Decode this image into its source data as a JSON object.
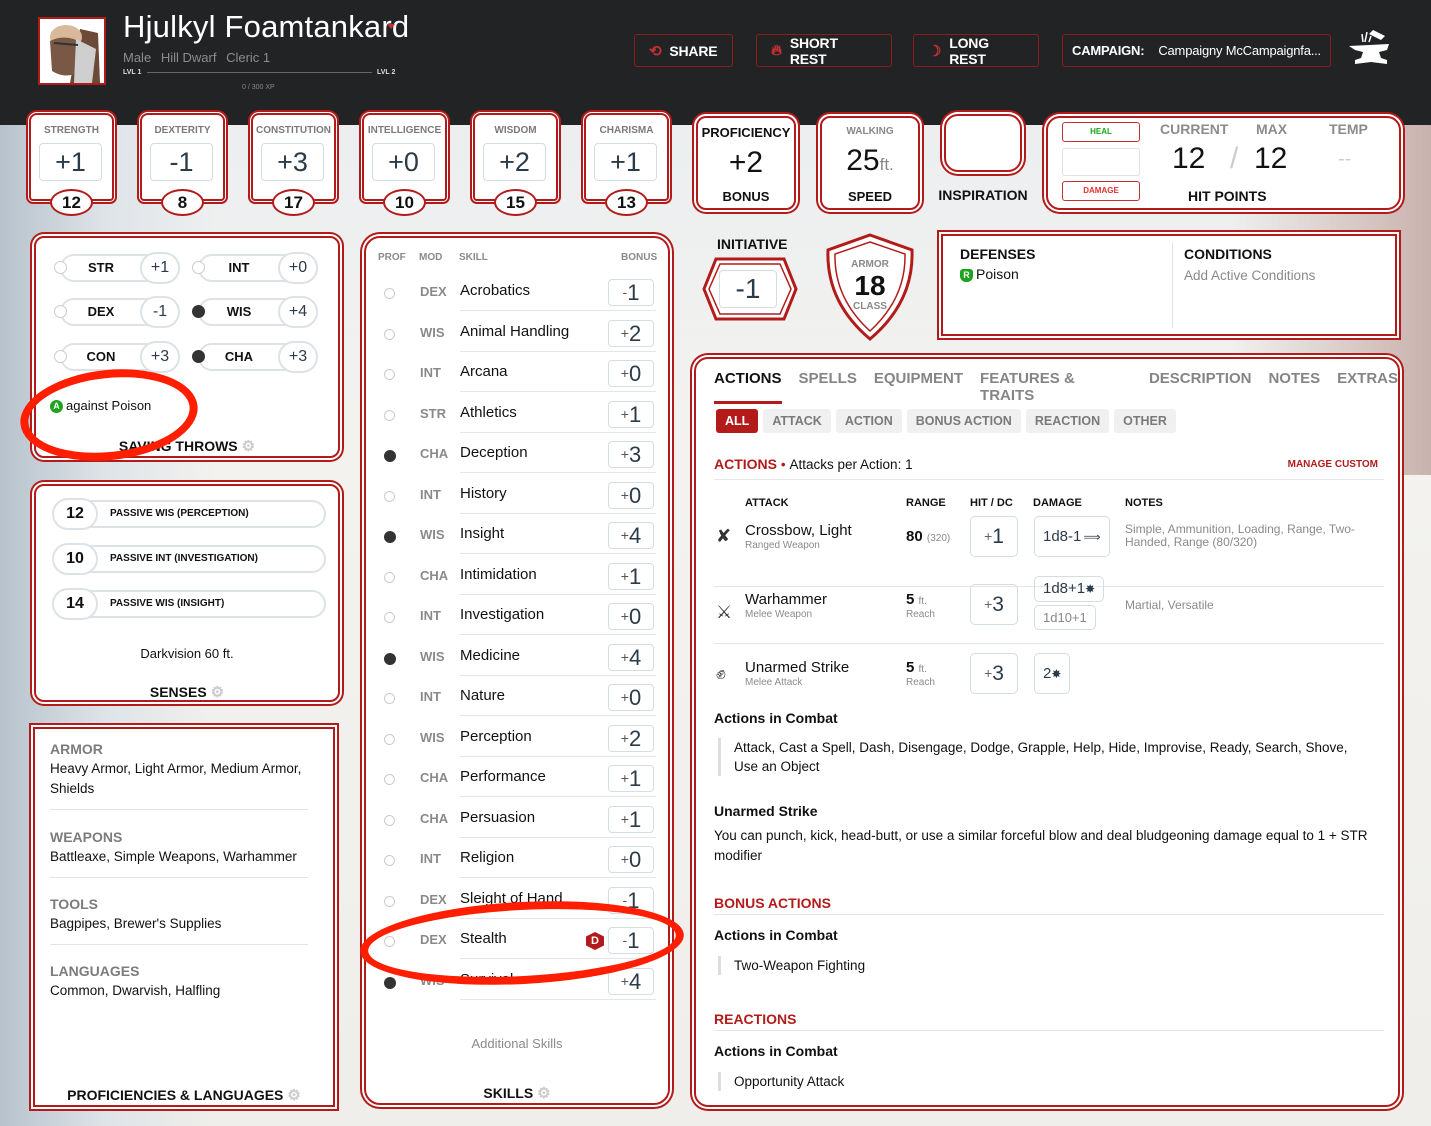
{
  "header": {
    "character_name": "Hjulkyl Foamtankard",
    "gender": "Male",
    "race": "Hill Dwarf",
    "class_level": "Cleric 1",
    "level_current": "LVL 1",
    "level_next": "LVL 2",
    "xp": "0 / 300 XP",
    "buttons": {
      "share": "SHARE",
      "short_rest": "SHORT REST",
      "long_rest": "LONG REST",
      "campaign_label": "CAMPAIGN:",
      "campaign_name": "Campaigny McCampaignfa..."
    }
  },
  "abilities": [
    {
      "name": "STRENGTH",
      "modifier": "+1",
      "score": "12"
    },
    {
      "name": "DEXTERITY",
      "modifier": "-1",
      "score": "8"
    },
    {
      "name": "CONSTITUTION",
      "modifier": "+3",
      "score": "17"
    },
    {
      "name": "INTELLIGENCE",
      "modifier": "+0",
      "score": "10"
    },
    {
      "name": "WISDOM",
      "modifier": "+2",
      "score": "15"
    },
    {
      "name": "CHARISMA",
      "modifier": "+1",
      "score": "13"
    }
  ],
  "proficiency": {
    "top": "PROFICIENCY",
    "value": "+2",
    "bottom": "BONUS"
  },
  "speed": {
    "top": "WALKING",
    "value": "25",
    "unit": "ft.",
    "bottom": "SPEED"
  },
  "inspiration": {
    "label": "INSPIRATION"
  },
  "hit_points": {
    "heal": "HEAL",
    "damage": "DAMAGE",
    "current_label": "CURRENT",
    "max_label": "MAX",
    "temp_label": "TEMP",
    "current": "12",
    "separator": "/",
    "max": "12",
    "temp": "--",
    "title": "HIT POINTS"
  },
  "initiative": {
    "label": "INITIATIVE",
    "value": "-1"
  },
  "armor_class": {
    "top": "ARMOR",
    "value": "18",
    "bottom": "CLASS"
  },
  "defenses": {
    "title": "DEFENSES",
    "badge": "R",
    "item": "Poison"
  },
  "conditions": {
    "title": "CONDITIONS",
    "placeholder": "Add Active Conditions"
  },
  "saving_throws": {
    "title": "SAVING THROWS",
    "items": [
      {
        "abbr": "STR",
        "value": "+1",
        "proficient": false
      },
      {
        "abbr": "INT",
        "value": "+0",
        "proficient": false
      },
      {
        "abbr": "DEX",
        "value": "-1",
        "proficient": false
      },
      {
        "abbr": "WIS",
        "value": "+4",
        "proficient": true
      },
      {
        "abbr": "CON",
        "value": "+3",
        "proficient": false
      },
      {
        "abbr": "CHA",
        "value": "+3",
        "proficient": true
      }
    ],
    "advantage_badge": "A",
    "advantage_note": "against Poison"
  },
  "senses": {
    "title": "SENSES",
    "items": [
      {
        "value": "12",
        "label": "PASSIVE WIS (PERCEPTION)"
      },
      {
        "value": "10",
        "label": "PASSIVE INT (INVESTIGATION)"
      },
      {
        "value": "14",
        "label": "PASSIVE WIS (INSIGHT)"
      }
    ],
    "note": "Darkvision 60 ft."
  },
  "proficiencies": {
    "title": "PROFICIENCIES & LANGUAGES",
    "sections": [
      {
        "heading": "ARMOR",
        "text": "Heavy Armor, Light Armor, Medium Armor, Shields"
      },
      {
        "heading": "WEAPONS",
        "text": "Battleaxe, Simple Weapons, Warhammer"
      },
      {
        "heading": "TOOLS",
        "text": "Bagpipes, Brewer's Supplies"
      },
      {
        "heading": "LANGUAGES",
        "text": "Common, Dwarvish, Halfling"
      }
    ]
  },
  "skills": {
    "title": "SKILLS",
    "headers": {
      "prof": "PROF",
      "mod": "MOD",
      "skill": "SKILL",
      "bonus": "BONUS"
    },
    "items": [
      {
        "mod": "DEX",
        "name": "Acrobatics",
        "sign": "-",
        "value": "1",
        "proficient": false
      },
      {
        "mod": "WIS",
        "name": "Animal Handling",
        "sign": "+",
        "value": "2",
        "proficient": false
      },
      {
        "mod": "INT",
        "name": "Arcana",
        "sign": "+",
        "value": "0",
        "proficient": false
      },
      {
        "mod": "STR",
        "name": "Athletics",
        "sign": "+",
        "value": "1",
        "proficient": false
      },
      {
        "mod": "CHA",
        "name": "Deception",
        "sign": "+",
        "value": "3",
        "proficient": true
      },
      {
        "mod": "INT",
        "name": "History",
        "sign": "+",
        "value": "0",
        "proficient": false
      },
      {
        "mod": "WIS",
        "name": "Insight",
        "sign": "+",
        "value": "4",
        "proficient": true
      },
      {
        "mod": "CHA",
        "name": "Intimidation",
        "sign": "+",
        "value": "1",
        "proficient": false
      },
      {
        "mod": "INT",
        "name": "Investigation",
        "sign": "+",
        "value": "0",
        "proficient": false
      },
      {
        "mod": "WIS",
        "name": "Medicine",
        "sign": "+",
        "value": "4",
        "proficient": true
      },
      {
        "mod": "INT",
        "name": "Nature",
        "sign": "+",
        "value": "0",
        "proficient": false
      },
      {
        "mod": "WIS",
        "name": "Perception",
        "sign": "+",
        "value": "2",
        "proficient": false
      },
      {
        "mod": "CHA",
        "name": "Performance",
        "sign": "+",
        "value": "1",
        "proficient": false
      },
      {
        "mod": "CHA",
        "name": "Persuasion",
        "sign": "+",
        "value": "1",
        "proficient": false
      },
      {
        "mod": "INT",
        "name": "Religion",
        "sign": "+",
        "value": "0",
        "proficient": false
      },
      {
        "mod": "DEX",
        "name": "Sleight of Hand",
        "sign": "-",
        "value": "1",
        "proficient": false
      },
      {
        "mod": "DEX",
        "name": "Stealth",
        "sign": "-",
        "value": "1",
        "proficient": false,
        "disadvantage": "D"
      },
      {
        "mod": "WIS",
        "name": "Survival",
        "sign": "+",
        "value": "4",
        "proficient": true
      }
    ],
    "additional": "Additional Skills"
  },
  "actions_panel": {
    "tabs": [
      "ACTIONS",
      "SPELLS",
      "EQUIPMENT",
      "FEATURES & TRAITS",
      "DESCRIPTION",
      "NOTES",
      "EXTRAS"
    ],
    "active_tab": "ACTIONS",
    "filters": [
      "ALL",
      "ATTACK",
      "ACTION",
      "BONUS ACTION",
      "REACTION",
      "OTHER"
    ],
    "active_filter": "ALL",
    "actions_title": "ACTIONS",
    "attacks_per_action": "Attacks per Action: 1",
    "manage_custom": "MANAGE CUSTOM",
    "columns": {
      "attack": "ATTACK",
      "range": "RANGE",
      "hit": "HIT / DC",
      "damage": "DAMAGE",
      "notes": "NOTES"
    },
    "attacks": [
      {
        "icon": "crossbow-icon",
        "name": "Crossbow, Light",
        "type": "Ranged Weapon",
        "range": "80",
        "range_long": "(320)",
        "reach": "",
        "hit_sign": "+",
        "hit": "1",
        "damage": "1d8-1",
        "damage_alt": "",
        "damage_type_icon": "piercing-icon",
        "notes": "Simple, Ammunition, Loading, Range, Two-Handed, Range (80/320)"
      },
      {
        "icon": "warhammer-icon",
        "name": "Warhammer",
        "type": "Melee Weapon",
        "range": "5",
        "range_unit": "ft.",
        "reach": "Reach",
        "hit_sign": "+",
        "hit": "3",
        "damage": "1d8+1",
        "damage_alt": "1d10+1",
        "damage_type_icon": "bludgeoning-icon",
        "notes": "Martial, Versatile"
      },
      {
        "icon": "fist-icon",
        "name": "Unarmed Strike",
        "type": "Melee Attack",
        "range": "5",
        "range_unit": "ft.",
        "reach": "Reach",
        "hit_sign": "+",
        "hit": "3",
        "damage": "2",
        "damage_alt": "",
        "damage_type_icon": "bludgeoning-icon",
        "notes": ""
      }
    ],
    "actions_in_combat_title": "Actions in Combat",
    "actions_in_combat": "Attack, Cast a Spell, Dash, Disengage, Dodge, Grapple, Help, Hide, Improvise, Ready, Search, Shove, Use an Object",
    "unarmed_title": "Unarmed Strike",
    "unarmed_text": "You can punch, kick, head-butt, or use a similar forceful blow and deal bludgeoning damage equal to 1 + STR modifier",
    "bonus_actions_title": "BONUS ACTIONS",
    "bonus_combat_title": "Actions in Combat",
    "bonus_combat": "Two-Weapon Fighting",
    "reactions_title": "REACTIONS",
    "reactions_combat_title": "Actions in Combat",
    "reactions_combat": "Opportunity Attack"
  },
  "colors": {
    "accent": "#b31b1b",
    "header_bg": "#222324",
    "heal": "#1ca51c",
    "damage": "#e03030",
    "annotation": "#ff1e00"
  }
}
